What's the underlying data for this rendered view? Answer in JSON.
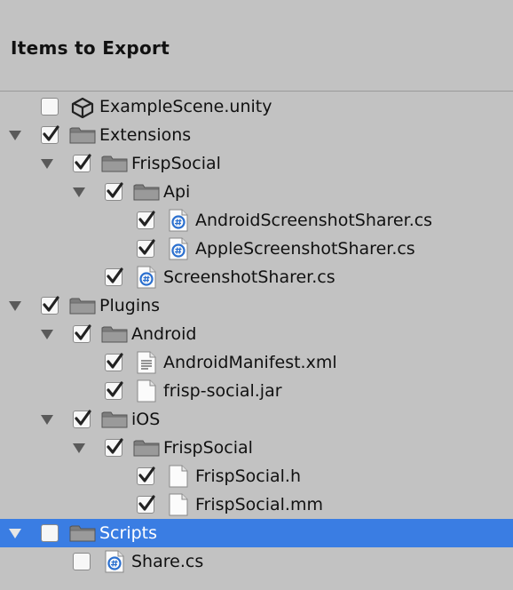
{
  "panel": {
    "title": "Items to Export"
  },
  "items": [
    {
      "label": "ExampleScene.unity",
      "icon": "unity-icon",
      "depth": 0,
      "expander": "none",
      "checked": false
    },
    {
      "label": "Extensions",
      "icon": "folder-icon",
      "depth": 0,
      "expander": "expanded",
      "checked": true
    },
    {
      "label": "FrispSocial",
      "icon": "folder-icon",
      "depth": 1,
      "expander": "expanded",
      "checked": true
    },
    {
      "label": "Api",
      "icon": "folder-icon",
      "depth": 2,
      "expander": "expanded",
      "checked": true
    },
    {
      "label": "AndroidScreenshotSharer.cs",
      "icon": "csharp-file-icon",
      "depth": 3,
      "expander": "none",
      "checked": true
    },
    {
      "label": "AppleScreenshotSharer.cs",
      "icon": "csharp-file-icon",
      "depth": 3,
      "expander": "none",
      "checked": true
    },
    {
      "label": "ScreenshotSharer.cs",
      "icon": "csharp-file-icon",
      "depth": 2,
      "expander": "none",
      "checked": true
    },
    {
      "label": "Plugins",
      "icon": "folder-icon",
      "depth": 0,
      "expander": "expanded",
      "checked": true
    },
    {
      "label": "Android",
      "icon": "folder-icon",
      "depth": 1,
      "expander": "expanded",
      "checked": true
    },
    {
      "label": "AndroidManifest.xml",
      "icon": "text-file-icon",
      "depth": 2,
      "expander": "none",
      "checked": true
    },
    {
      "label": "frisp-social.jar",
      "icon": "file-icon",
      "depth": 2,
      "expander": "none",
      "checked": true
    },
    {
      "label": "iOS",
      "icon": "folder-icon",
      "depth": 1,
      "expander": "expanded",
      "checked": true
    },
    {
      "label": "FrispSocial",
      "icon": "folder-icon",
      "depth": 2,
      "expander": "expanded",
      "checked": true
    },
    {
      "label": "FrispSocial.h",
      "icon": "file-icon",
      "depth": 3,
      "expander": "none",
      "checked": true
    },
    {
      "label": "FrispSocial.mm",
      "icon": "file-icon",
      "depth": 3,
      "expander": "none",
      "checked": true
    },
    {
      "label": "Scripts",
      "icon": "folder-icon",
      "depth": 0,
      "expander": "expanded",
      "checked": false,
      "selected": true
    },
    {
      "label": "Share.cs",
      "icon": "csharp-file-icon",
      "depth": 1,
      "expander": "none",
      "checked": false
    }
  ],
  "colors": {
    "selection": "#3a7de3",
    "background": "#c2c2c2",
    "csharp_icon": "#2a6fcf"
  }
}
